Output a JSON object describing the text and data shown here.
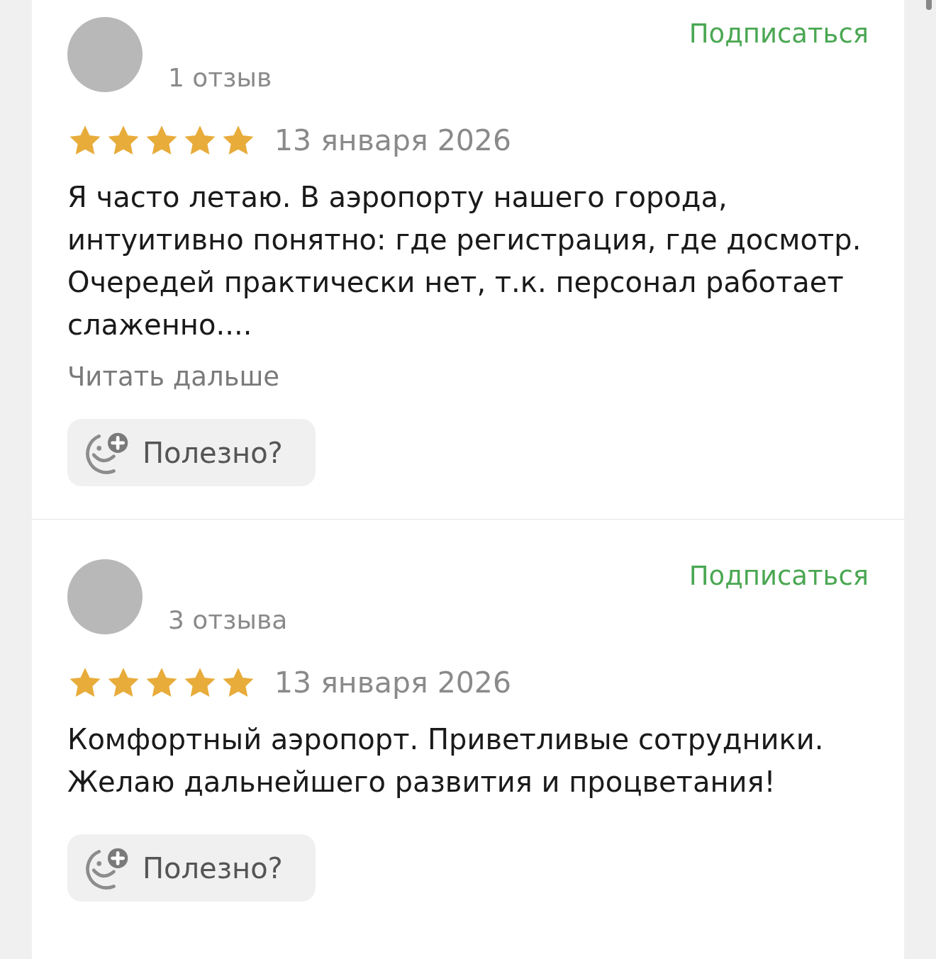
{
  "reviews": [
    {
      "review_count": "1 отзыв",
      "subscribe": "Подписаться",
      "stars": 5,
      "date": "13 января 2026",
      "text": "Я часто летаю. В аэропорту нашего города, интуитивно понятно: где регистрация, где досмотр. Очередей практически нет, т.к. персонал работает слаженно....",
      "read_more": "Читать дальше",
      "helpful": "Полезно?"
    },
    {
      "review_count": "3 отзыва",
      "subscribe": "Подписаться",
      "stars": 5,
      "date": "13 января 2026",
      "text": "Комфортный аэропорт. Приветливые сотрудники. Желаю дальнейшего развития и процветания!",
      "helpful": "Полезно?"
    }
  ]
}
